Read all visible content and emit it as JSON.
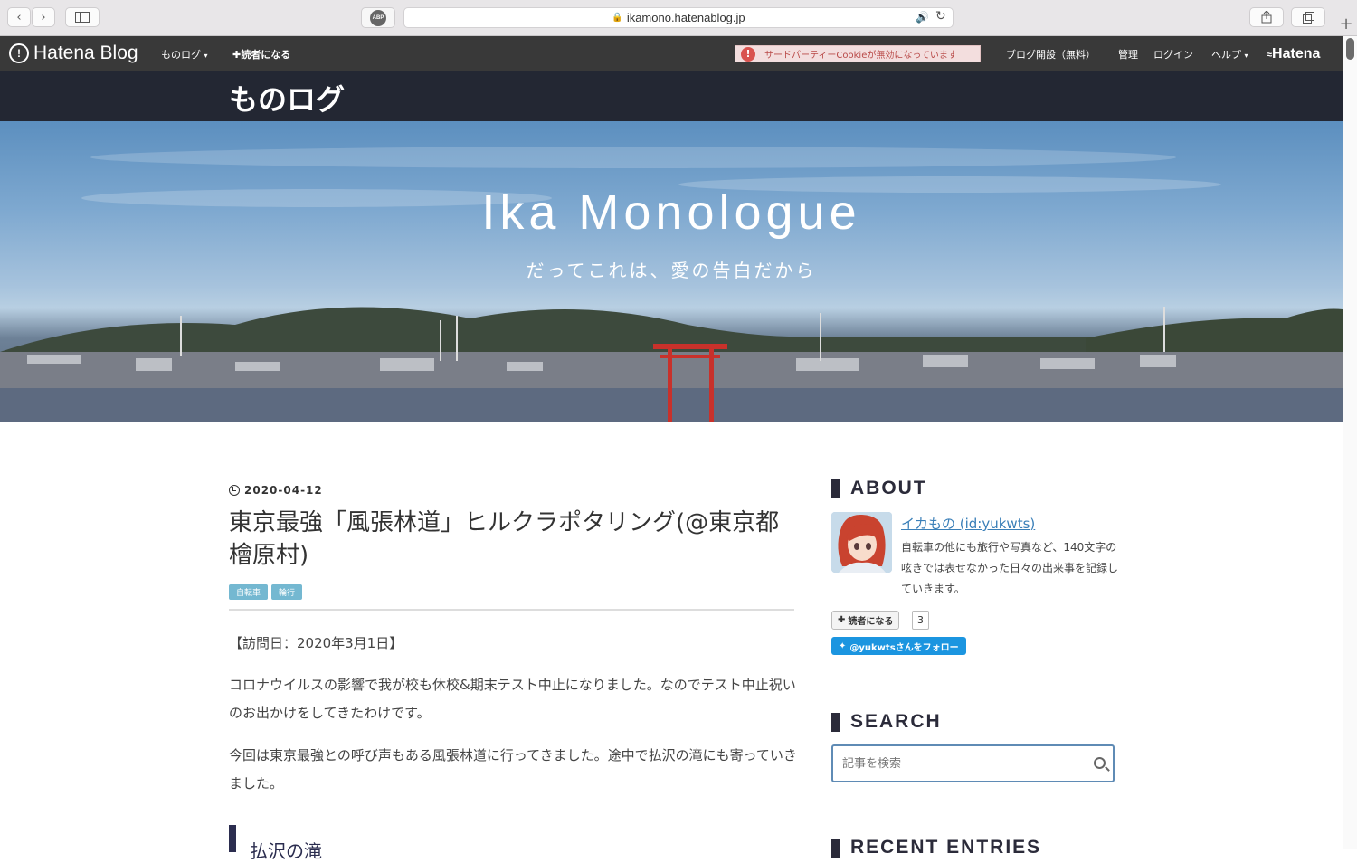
{
  "browser": {
    "url": "ikamono.hatenablog.jp",
    "abp_label": "ABP",
    "icons": [
      "back-arrow-icon",
      "forward-arrow-icon",
      "sidebar-icon",
      "lock-icon",
      "speaker-icon",
      "reload-icon",
      "share-icon",
      "tabs-icon",
      "plus-icon"
    ]
  },
  "hatena_nav": {
    "logo_text": "Hatena Blog",
    "blog_menu": "ものログ",
    "subscribe": "読者になる",
    "cookie_warning": "サードパーティーCookieが無効になっています",
    "open_blog": "ブログ開設（無料）",
    "admin": "管理",
    "login": "ログイン",
    "help": "ヘルプ",
    "brand": "Hatena"
  },
  "blog": {
    "title": "ものログ",
    "hero_title": "Ika Monologue",
    "hero_subtitle": "だってこれは、愛の告白だから"
  },
  "post": {
    "date": "2020-04-12",
    "title": "東京最強「風張林道」ヒルクラポタリング(@東京都檜原村)",
    "tags": [
      "自転車",
      "輪行"
    ],
    "visit_date": "【訪問日：2020年3月1日】",
    "para1": "コロナウイルスの影響で我が校も休校&期末テスト中止になりました。なのでテスト中止祝いのお出かけをしてきたわけです。",
    "para2": "今回は東京最強との呼び声もある風張林道に行ってきました。途中で払沢の滝にも寄っていきました。",
    "section_heading": "払沢の滝"
  },
  "sidebar": {
    "about_heading": "ABOUT",
    "author_name": "イカもの (id:yukwts)",
    "author_desc": "自転車の他にも旅行や写真など、140文字の呟きでは表せなかった日々の出来事を記録していきます。",
    "subscribe_label": "読者になる",
    "subscriber_count": "3",
    "twitter_follow": "@yukwtsさんをフォロー",
    "search_heading": "SEARCH",
    "search_placeholder": "記事を検索",
    "recent_heading": "RECENT ENTRIES"
  },
  "colors": {
    "nav_bg": "#393939",
    "header_bg": "#232733",
    "tag_bg": "#74b8d1",
    "link": "#3a7fb8",
    "twitter": "#1b95e0"
  }
}
